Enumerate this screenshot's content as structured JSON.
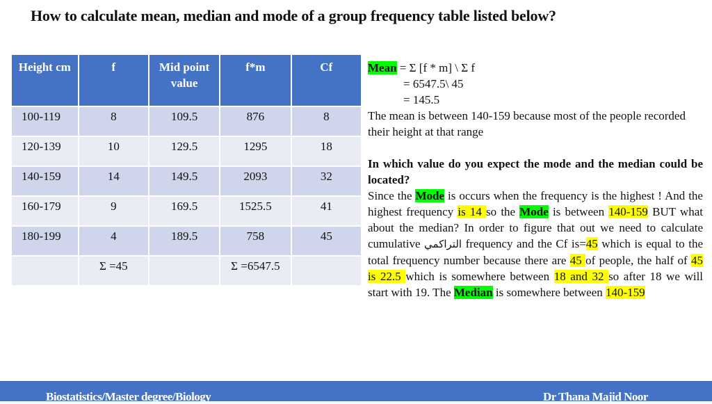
{
  "title": "How to calculate mean, median and mode of a group frequency table listed below?",
  "table": {
    "headers": [
      "Height cm",
      "f",
      "Mid point value",
      "f*m",
      "Cf"
    ],
    "rows": [
      [
        "100-119",
        "8",
        "109.5",
        "876",
        "8"
      ],
      [
        "120-139",
        "10",
        "129.5",
        "1295",
        "18"
      ],
      [
        "140-159",
        "14",
        "149.5",
        "2093",
        "32"
      ],
      [
        "160-179",
        "9",
        "169.5",
        "1525.5",
        "41"
      ],
      [
        "180-199",
        "4",
        "189.5",
        "758",
        "45"
      ]
    ],
    "totals": [
      "",
      "Σ =45",
      "",
      "Σ =6547.5",
      ""
    ]
  },
  "explanation": {
    "mean_label": "Mean",
    "mean_formula": " = Σ [f * m] \\ Σ f",
    "mean_step1": "= 6547.5\\ 45",
    "mean_step2": "= 145.5",
    "mean_note": "The mean is between 140-159 because most of the people recorded their height at that range",
    "question": "In which value do you expect the mode and the median could be located?",
    "p1": "Since the ",
    "mode_label": "Mode",
    "p2": " is occurs when the frequency is the highest ! And the highest frequency ",
    "hl_is14": "is 14 ",
    "p3": "so the ",
    "p4": " is between ",
    "hl_range1": "140-159",
    "p5": " BUT what about the median? In order to figure that out we need to calculate cumulative ",
    "arabic_word": "التراكمي",
    "p6": " frequency and the Cf is=",
    "hl_45a": "45",
    "p7": " which is equal to the total frequency number because there are ",
    "hl_45b": "45 ",
    "p8": "of people, the half of ",
    "hl_half": "45 is 22.5 ",
    "p9": "which is somewhere between ",
    "hl_between": "18 and 32 ",
    "p10": "so after 18 we will start with 19. The ",
    "median_label": "Median",
    "p11": " is somewhere between ",
    "hl_range2": "140-159"
  },
  "footer": {
    "left": "Biostatistics/Master degree/Biology",
    "right": "Dr Thana Majid Noor"
  }
}
